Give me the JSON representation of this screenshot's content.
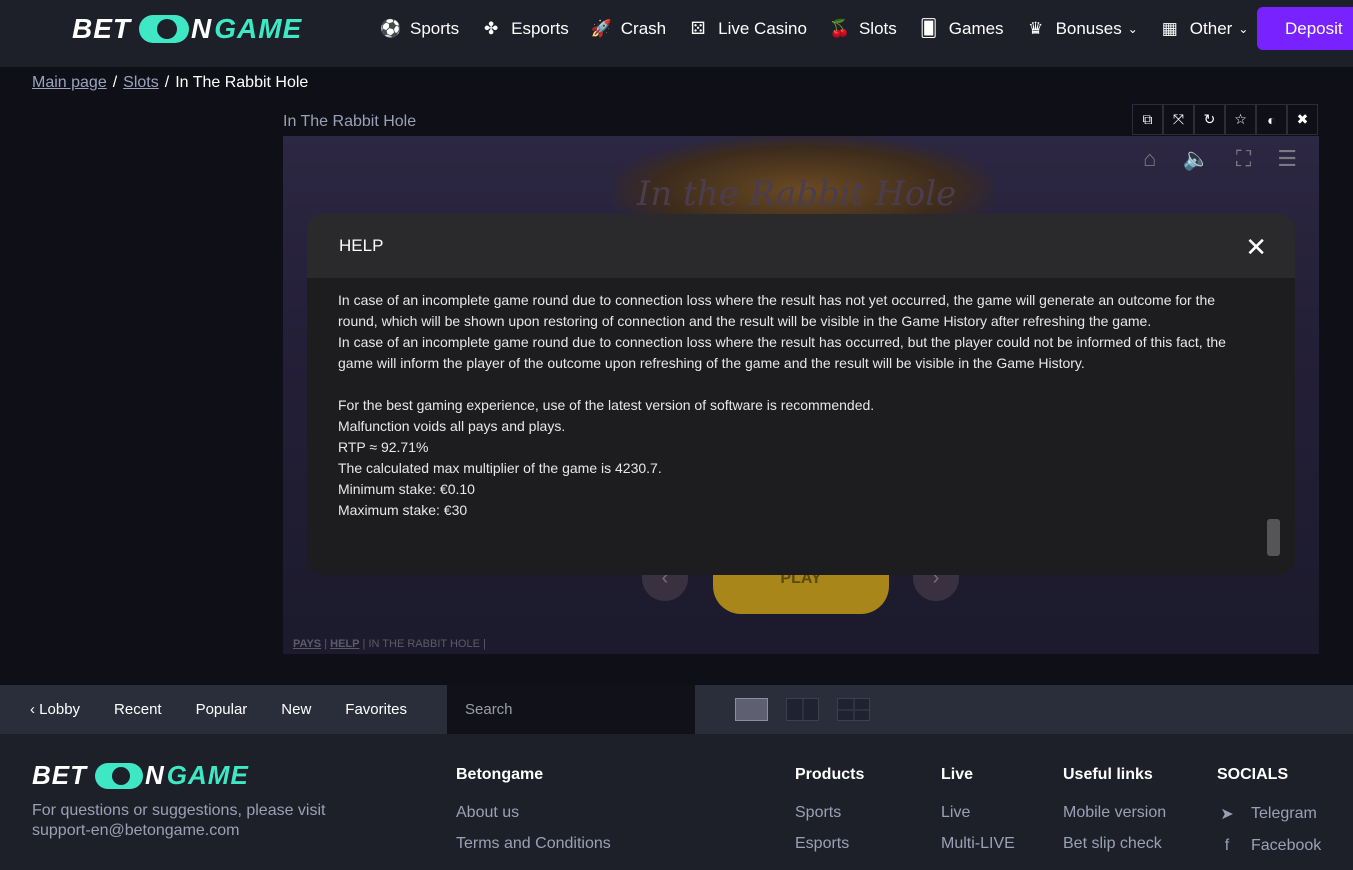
{
  "header": {
    "logo": {
      "bet": "BET",
      "n": "N",
      "game": "GAME"
    },
    "nav": [
      {
        "label": "Sports",
        "icon": "⚽"
      },
      {
        "label": "Esports",
        "icon": "✤"
      },
      {
        "label": "Crash",
        "icon": "🚀"
      },
      {
        "label": "Live Casino",
        "icon": "⚄"
      },
      {
        "label": "Slots",
        "icon": "🍒"
      },
      {
        "label": "Games",
        "icon": "🂠"
      },
      {
        "label": "Bonuses",
        "icon": "♛"
      },
      {
        "label": "Other",
        "icon": "▦"
      }
    ],
    "deposit": "Deposit"
  },
  "breadcrumb": {
    "home": "Main page",
    "slots": "Slots",
    "current": "In The Rabbit Hole",
    "sep": "/"
  },
  "game": {
    "title": "In The Rabbit Hole",
    "banner": "In the Rabbit Hole",
    "play": "PLAY",
    "footer": {
      "pays": "PAYS",
      "help": "HELP",
      "name": "IN THE RABBIT HOLE"
    }
  },
  "help": {
    "title": "HELP",
    "para1_l1": "In case of an incomplete game round due to connection loss where the result has not yet occurred, the game will generate an outcome for the",
    "para1_l2": "round, which will be shown upon restoring of connection and the result will be visible in the Game History after refreshing the game.",
    "para2_l1": "In case of an incomplete game round due to connection loss where the result has occurred, but the player could not be informed of this fact, the",
    "para2_l2": "game will inform the player of the outcome upon refreshing of the game and the result will be visible in the Game History.",
    "best": "For the best gaming experience, use of the latest version of software is recommended.",
    "malfunction": "Malfunction voids all pays and plays.",
    "rtp": "RTP ≈ 92.71%",
    "maxmult": "The calculated max multiplier of the game is 4230.7.",
    "minstake": "Minimum stake: €0.10",
    "maxstake": "Maximum stake: €30"
  },
  "toolbar": {
    "lobby": "Lobby",
    "recent": "Recent",
    "popular": "Popular",
    "new": "New",
    "favorites": "Favorites",
    "search_placeholder": "Search"
  },
  "footer": {
    "support_l1": "For questions or suggestions, please visit",
    "support_l2": "support-en@betongame.com",
    "cols": {
      "betongame": {
        "title": "Betongame",
        "links": [
          "About us",
          "Terms and Conditions"
        ]
      },
      "products": {
        "title": "Products",
        "links": [
          "Sports",
          "Esports"
        ]
      },
      "live": {
        "title": "Live",
        "links": [
          "Live",
          "Multi-LIVE"
        ]
      },
      "useful": {
        "title": "Useful links",
        "links": [
          "Mobile version",
          "Bet slip check"
        ]
      },
      "socials": {
        "title": "SOCIALS",
        "links": [
          "Telegram",
          "Facebook"
        ]
      }
    }
  },
  "colors": {
    "accent": "#3ee8c5",
    "deposit": "#7722ff"
  }
}
